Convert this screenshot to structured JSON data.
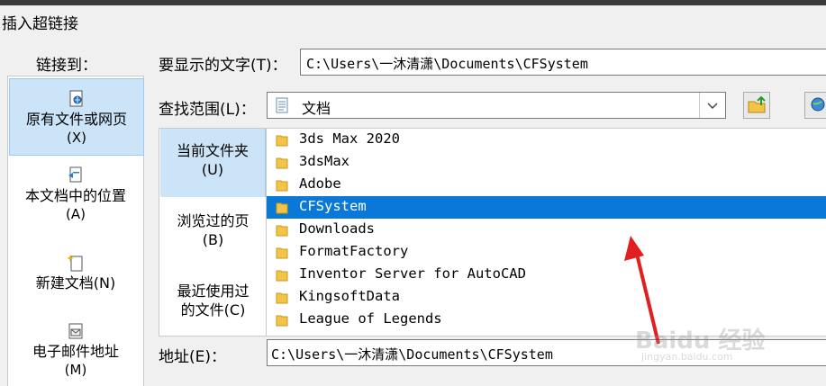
{
  "dialog": {
    "title": "插入超链接"
  },
  "nav": {
    "label": "链接到：",
    "items": [
      {
        "line1": "原有文件或网页",
        "accel": "(X)"
      },
      {
        "line1": "本文档中的位置",
        "accel": "(A)"
      },
      {
        "line1": "新建文档(N)",
        "accel": ""
      },
      {
        "line1": "电子邮件地址",
        "accel": "(M)"
      }
    ]
  },
  "display_text": {
    "label": "要显示的文字(T)：",
    "value": "C:\\Users\\一沐清潇\\Documents\\CFSystem"
  },
  "look_in": {
    "label": "查找范围(L)：",
    "value": "文档"
  },
  "places": [
    {
      "line1": "当前文件夹",
      "line2": "(U)"
    },
    {
      "line1": "浏览过的页",
      "line2": "(B)"
    },
    {
      "line1": "最近使用过",
      "line2": "的文件(C)"
    }
  ],
  "files": [
    "3ds Max 2020",
    "3dsMax",
    "Adobe",
    "CFSystem",
    "Downloads",
    "FormatFactory",
    "Inventor Server for AutoCAD",
    "KingsoftData",
    "League of Legends"
  ],
  "selected_file": "CFSystem",
  "address": {
    "label": "地址(E)：",
    "value": "C:\\Users\\一沐清潇\\Documents\\CFSystem"
  },
  "watermark": {
    "main": "Baidu 经验",
    "sub": "jingyan.baidu.com"
  },
  "colors": {
    "selection": "#0a78d7",
    "nav_selected": "#cce4f7",
    "folder": "#f3c447",
    "arrow": "#e02020"
  }
}
